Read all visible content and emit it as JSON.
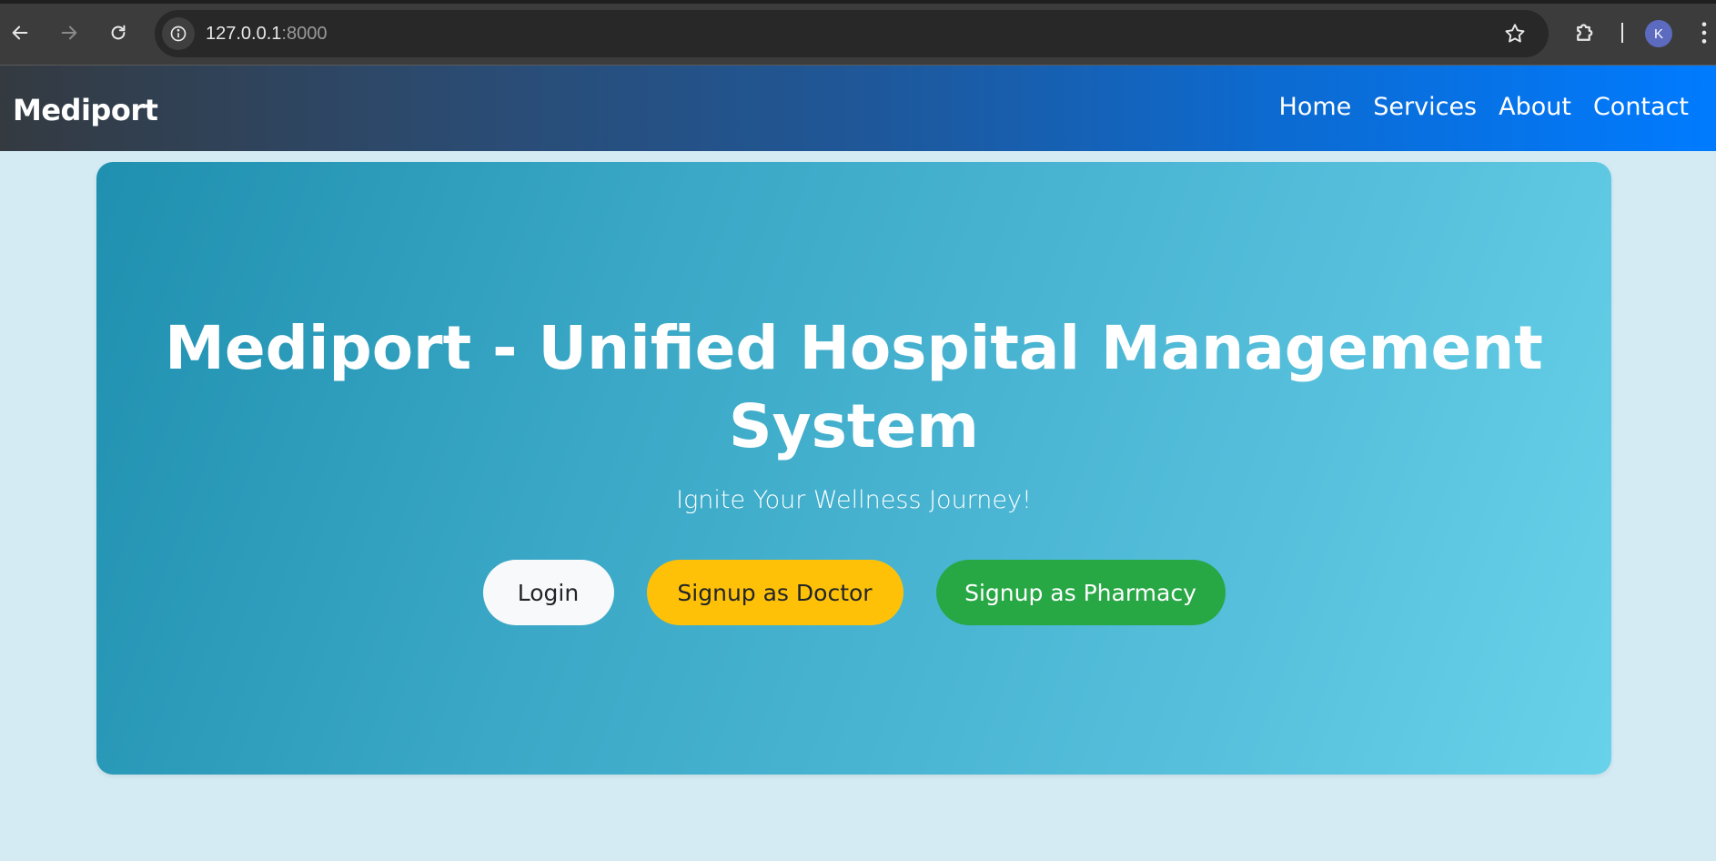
{
  "browser": {
    "url_host": "127.0.0.1",
    "url_port": ":8000",
    "profile_initial": "K"
  },
  "navbar": {
    "brand": "Mediport",
    "links": [
      "Home",
      "Services",
      "About",
      "Contact"
    ]
  },
  "hero": {
    "title": "Mediport - Unified Hospital Management System",
    "subtitle": "Ignite Your Wellness Journey!",
    "buttons": {
      "login": "Login",
      "signup_doctor": "Signup as Doctor",
      "signup_pharmacy": "Signup as Pharmacy"
    }
  },
  "colors": {
    "page_background": "#d4ebf4",
    "hero_gradient_start": "#2090b0",
    "hero_gradient_end": "#68d2ea",
    "navbar_gradient_start": "#343a40",
    "navbar_gradient_end": "#007bff",
    "login_button": "#f8f9fa",
    "doctor_button": "#ffc107",
    "pharmacy_button": "#28a745"
  },
  "icons": {
    "back": "arrow-left-icon",
    "forward": "arrow-right-icon",
    "reload": "reload-icon",
    "site_info": "info-icon",
    "bookmark": "star-icon",
    "extensions": "puzzle-icon",
    "menu": "kebab-menu-icon"
  }
}
